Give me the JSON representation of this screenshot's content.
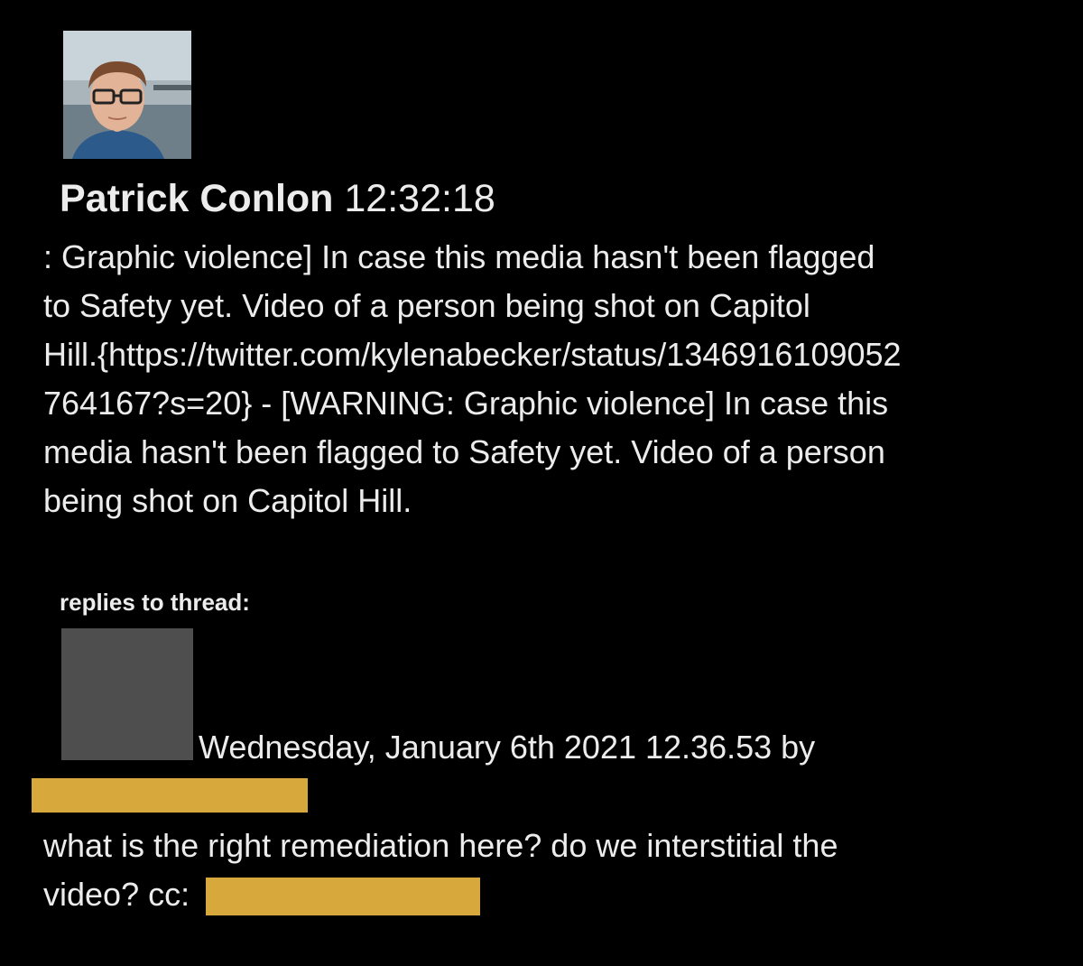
{
  "post": {
    "author": "Patrick Conlon",
    "time": "12:32:18",
    "body_lines": [
      " : Graphic violence] In case this media hasn't been flagged",
      "to Safety yet. Video of a person being shot on Capitol",
      "Hill.{https://twitter.com/kylenabecker/status/1346916109052",
      "764167?s=20} - [WARNING: Graphic violence] In case this",
      "media hasn't been flagged to Safety yet. Video of a person",
      "being shot on Capitol Hill."
    ]
  },
  "replies": {
    "label": "replies to thread:",
    "reply": {
      "meta": "Wednesday, January 6th 2021 12.36.53 by",
      "text_lines": [
        " what is the right remediation here? do we interstitial the",
        "video? cc:"
      ]
    }
  },
  "colors": {
    "background": "#000000",
    "text": "#ececec",
    "redaction": "#d7a93c",
    "avatar_placeholder": "#4e4e4e"
  },
  "icons": {
    "author_avatar": "profile-photo",
    "reply_avatar": "gray-placeholder"
  }
}
